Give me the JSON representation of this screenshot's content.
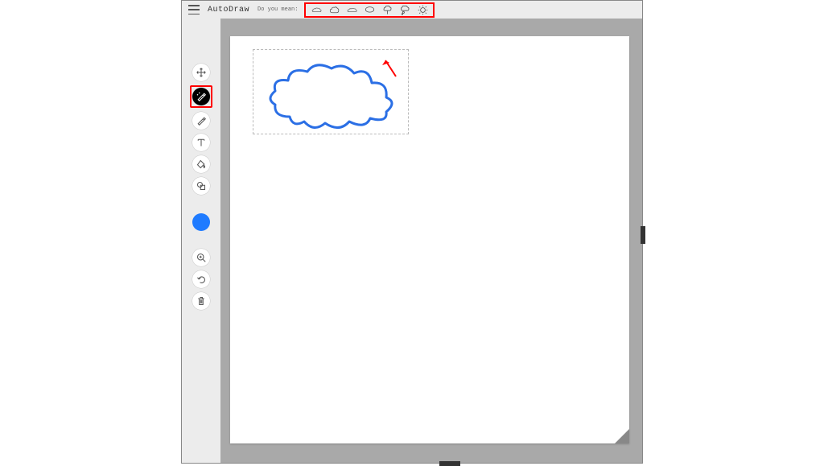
{
  "header": {
    "app_title": "AutoDraw",
    "suggest_label": "Do you mean:",
    "suggestions": [
      {
        "name": "cloud-a"
      },
      {
        "name": "cloud-b"
      },
      {
        "name": "cloud-c"
      },
      {
        "name": "speech-bubble"
      },
      {
        "name": "tree"
      },
      {
        "name": "thought-bubble"
      },
      {
        "name": "sun-outline"
      }
    ]
  },
  "tools": {
    "move": "Select",
    "auto": "AutoDraw",
    "draw": "Draw",
    "text": "Type",
    "fill": "Fill",
    "shape": "Shape"
  },
  "utilities": {
    "zoom": "Zoom",
    "undo": "Undo",
    "delete": "Delete"
  },
  "colors": {
    "current": "#1f7bff",
    "stroke": "#2b6fe5",
    "highlight": "#ff0000"
  },
  "canvas": {
    "drawing_label": "cloud-sketch",
    "selected": true
  }
}
